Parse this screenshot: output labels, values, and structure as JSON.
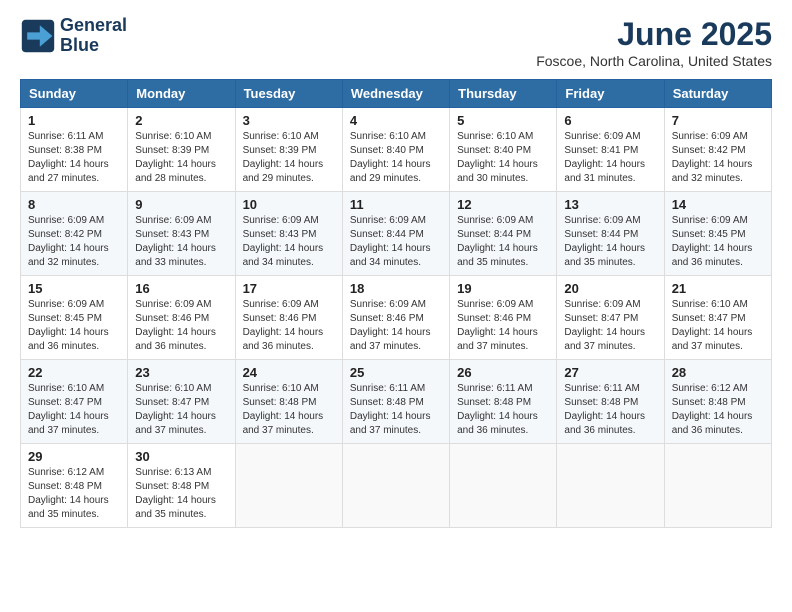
{
  "header": {
    "logo_line1": "General",
    "logo_line2": "Blue",
    "month": "June 2025",
    "location": "Foscoe, North Carolina, United States"
  },
  "weekdays": [
    "Sunday",
    "Monday",
    "Tuesday",
    "Wednesday",
    "Thursday",
    "Friday",
    "Saturday"
  ],
  "weeks": [
    [
      {
        "day": "1",
        "info": "Sunrise: 6:11 AM\nSunset: 8:38 PM\nDaylight: 14 hours\nand 27 minutes."
      },
      {
        "day": "2",
        "info": "Sunrise: 6:10 AM\nSunset: 8:39 PM\nDaylight: 14 hours\nand 28 minutes."
      },
      {
        "day": "3",
        "info": "Sunrise: 6:10 AM\nSunset: 8:39 PM\nDaylight: 14 hours\nand 29 minutes."
      },
      {
        "day": "4",
        "info": "Sunrise: 6:10 AM\nSunset: 8:40 PM\nDaylight: 14 hours\nand 29 minutes."
      },
      {
        "day": "5",
        "info": "Sunrise: 6:10 AM\nSunset: 8:40 PM\nDaylight: 14 hours\nand 30 minutes."
      },
      {
        "day": "6",
        "info": "Sunrise: 6:09 AM\nSunset: 8:41 PM\nDaylight: 14 hours\nand 31 minutes."
      },
      {
        "day": "7",
        "info": "Sunrise: 6:09 AM\nSunset: 8:42 PM\nDaylight: 14 hours\nand 32 minutes."
      }
    ],
    [
      {
        "day": "8",
        "info": "Sunrise: 6:09 AM\nSunset: 8:42 PM\nDaylight: 14 hours\nand 32 minutes."
      },
      {
        "day": "9",
        "info": "Sunrise: 6:09 AM\nSunset: 8:43 PM\nDaylight: 14 hours\nand 33 minutes."
      },
      {
        "day": "10",
        "info": "Sunrise: 6:09 AM\nSunset: 8:43 PM\nDaylight: 14 hours\nand 34 minutes."
      },
      {
        "day": "11",
        "info": "Sunrise: 6:09 AM\nSunset: 8:44 PM\nDaylight: 14 hours\nand 34 minutes."
      },
      {
        "day": "12",
        "info": "Sunrise: 6:09 AM\nSunset: 8:44 PM\nDaylight: 14 hours\nand 35 minutes."
      },
      {
        "day": "13",
        "info": "Sunrise: 6:09 AM\nSunset: 8:44 PM\nDaylight: 14 hours\nand 35 minutes."
      },
      {
        "day": "14",
        "info": "Sunrise: 6:09 AM\nSunset: 8:45 PM\nDaylight: 14 hours\nand 36 minutes."
      }
    ],
    [
      {
        "day": "15",
        "info": "Sunrise: 6:09 AM\nSunset: 8:45 PM\nDaylight: 14 hours\nand 36 minutes."
      },
      {
        "day": "16",
        "info": "Sunrise: 6:09 AM\nSunset: 8:46 PM\nDaylight: 14 hours\nand 36 minutes."
      },
      {
        "day": "17",
        "info": "Sunrise: 6:09 AM\nSunset: 8:46 PM\nDaylight: 14 hours\nand 36 minutes."
      },
      {
        "day": "18",
        "info": "Sunrise: 6:09 AM\nSunset: 8:46 PM\nDaylight: 14 hours\nand 37 minutes."
      },
      {
        "day": "19",
        "info": "Sunrise: 6:09 AM\nSunset: 8:46 PM\nDaylight: 14 hours\nand 37 minutes."
      },
      {
        "day": "20",
        "info": "Sunrise: 6:09 AM\nSunset: 8:47 PM\nDaylight: 14 hours\nand 37 minutes."
      },
      {
        "day": "21",
        "info": "Sunrise: 6:10 AM\nSunset: 8:47 PM\nDaylight: 14 hours\nand 37 minutes."
      }
    ],
    [
      {
        "day": "22",
        "info": "Sunrise: 6:10 AM\nSunset: 8:47 PM\nDaylight: 14 hours\nand 37 minutes."
      },
      {
        "day": "23",
        "info": "Sunrise: 6:10 AM\nSunset: 8:47 PM\nDaylight: 14 hours\nand 37 minutes."
      },
      {
        "day": "24",
        "info": "Sunrise: 6:10 AM\nSunset: 8:48 PM\nDaylight: 14 hours\nand 37 minutes."
      },
      {
        "day": "25",
        "info": "Sunrise: 6:11 AM\nSunset: 8:48 PM\nDaylight: 14 hours\nand 37 minutes."
      },
      {
        "day": "26",
        "info": "Sunrise: 6:11 AM\nSunset: 8:48 PM\nDaylight: 14 hours\nand 36 minutes."
      },
      {
        "day": "27",
        "info": "Sunrise: 6:11 AM\nSunset: 8:48 PM\nDaylight: 14 hours\nand 36 minutes."
      },
      {
        "day": "28",
        "info": "Sunrise: 6:12 AM\nSunset: 8:48 PM\nDaylight: 14 hours\nand 36 minutes."
      }
    ],
    [
      {
        "day": "29",
        "info": "Sunrise: 6:12 AM\nSunset: 8:48 PM\nDaylight: 14 hours\nand 35 minutes."
      },
      {
        "day": "30",
        "info": "Sunrise: 6:13 AM\nSunset: 8:48 PM\nDaylight: 14 hours\nand 35 minutes."
      },
      {
        "day": "",
        "info": ""
      },
      {
        "day": "",
        "info": ""
      },
      {
        "day": "",
        "info": ""
      },
      {
        "day": "",
        "info": ""
      },
      {
        "day": "",
        "info": ""
      }
    ]
  ]
}
